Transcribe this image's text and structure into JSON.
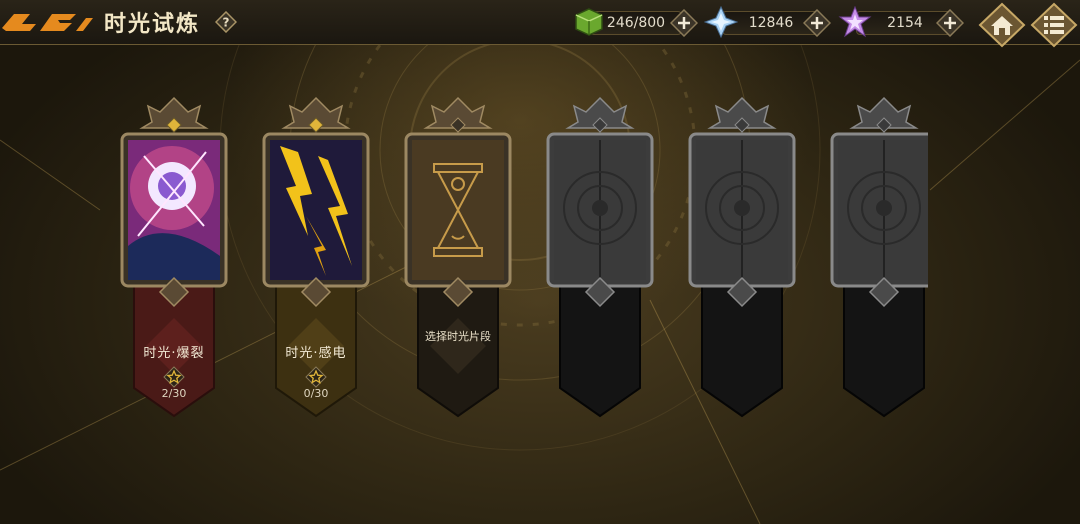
{
  "header": {
    "title": "时光试炼",
    "help_icon": "question-diamond-icon",
    "back_icon": "back-arrow-icon"
  },
  "resources": [
    {
      "name": "stamina",
      "icon": "green-cube-icon",
      "value": "246/800",
      "color": "#7fbf3a"
    },
    {
      "name": "crystal",
      "icon": "blue-crystal-icon",
      "value": "12846",
      "color": "#9ec8f0"
    },
    {
      "name": "star-gem",
      "icon": "purple-star-gem-icon",
      "value": "2154",
      "color": "#c58be8"
    }
  ],
  "nav": {
    "home_icon": "home-icon",
    "menu_icon": "menu-icon"
  },
  "slots": [
    {
      "state": "active",
      "name": "时光·爆裂",
      "progress": "2/30",
      "banner_color": "#5a1f1c",
      "art": "burst-art"
    },
    {
      "state": "active",
      "name": "时光·感电",
      "progress": "0/30",
      "banner_color": "#4a3a16",
      "art": "electric-art"
    },
    {
      "state": "select",
      "prompt": "选择时光片段",
      "banner_color": "#2a2418",
      "art": "hourglass-art"
    },
    {
      "state": "locked",
      "banner_color": "#151515",
      "art": "locked-art"
    },
    {
      "state": "locked",
      "banner_color": "#151515",
      "art": "locked-art"
    },
    {
      "state": "locked",
      "banner_color": "#151515",
      "art": "locked-art"
    }
  ]
}
